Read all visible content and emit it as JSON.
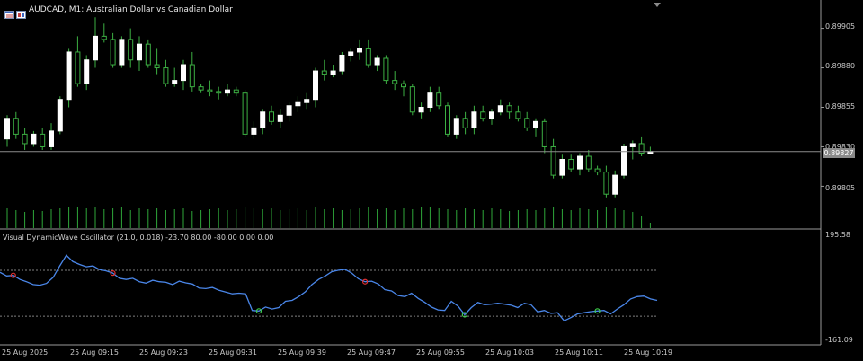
{
  "title": "AUDCAD, M1:  Australian Dollar vs Canadian Dollar",
  "indicator": "Visual DynamicWave Oscillator (21.0, 0.018) -23.70 80.00 -80.00 0.00 0.00",
  "price_axis": [
    "0.89905",
    "0.89880",
    "0.89855",
    "0.89830",
    "0.89805"
  ],
  "current_price": "0.89827",
  "osc_axis": [
    "195.58",
    "-161.09"
  ],
  "time_axis": [
    "25 Aug 2025",
    "25 Aug 09:15",
    "25 Aug 09:23",
    "25 Aug 09:31",
    "25 Aug 09:39",
    "25 Aug 09:47",
    "25 Aug 09:55",
    "25 Aug 10:03",
    "25 Aug 10:11",
    "25 Aug 10:19"
  ],
  "icons": [
    "chart-menu-icon",
    "one-click-trading-icon"
  ],
  "colors": {
    "background": "#000000",
    "bull_candle": "#ffffff",
    "wick": "#3cb043",
    "volume": "#2fa83a",
    "oscillator": "#4a86e8",
    "level_line": "#808080",
    "sell_signal": "#e03030",
    "buy_signal": "#3cd04a"
  },
  "chart_data": [
    {
      "type": "candlestick",
      "title": "AUDCAD, M1",
      "y_range": [
        0.89795,
        0.89915
      ],
      "candles": [
        [
          0.89835,
          0.8985,
          0.8983,
          0.89848
        ],
        [
          0.89848,
          0.89852,
          0.89835,
          0.89838
        ],
        [
          0.89838,
          0.89842,
          0.89828,
          0.89832
        ],
        [
          0.89832,
          0.8984,
          0.8983,
          0.89838
        ],
        [
          0.89838,
          0.89842,
          0.89828,
          0.8983
        ],
        [
          0.8983,
          0.89845,
          0.89828,
          0.8984
        ],
        [
          0.8984,
          0.89862,
          0.89838,
          0.8986
        ],
        [
          0.8986,
          0.89892,
          0.89855,
          0.8989
        ],
        [
          0.8989,
          0.899,
          0.89868,
          0.8987
        ],
        [
          0.8987,
          0.89888,
          0.89866,
          0.89885
        ],
        [
          0.89885,
          0.89912,
          0.8988,
          0.899
        ],
        [
          0.899,
          0.89908,
          0.89896,
          0.89898
        ],
        [
          0.89898,
          0.89902,
          0.8988,
          0.89882
        ],
        [
          0.89882,
          0.899,
          0.8988,
          0.89898
        ],
        [
          0.89898,
          0.89905,
          0.8988,
          0.89885
        ],
        [
          0.89885,
          0.899,
          0.89878,
          0.89895
        ],
        [
          0.89895,
          0.89898,
          0.8988,
          0.89882
        ],
        [
          0.89882,
          0.89892,
          0.89876,
          0.8988
        ],
        [
          0.8988,
          0.89885,
          0.89868,
          0.8987
        ],
        [
          0.8987,
          0.8988,
          0.89868,
          0.89872
        ],
        [
          0.89872,
          0.89885,
          0.89866,
          0.89882
        ],
        [
          0.89882,
          0.8989,
          0.89865,
          0.89868
        ],
        [
          0.89868,
          0.8987,
          0.89864,
          0.89866
        ],
        [
          0.89866,
          0.89872,
          0.89862,
          0.89865
        ],
        [
          0.89865,
          0.89868,
          0.8986,
          0.89864
        ],
        [
          0.89864,
          0.8987,
          0.89862,
          0.89866
        ],
        [
          0.89866,
          0.89868,
          0.89862,
          0.89864
        ],
        [
          0.89864,
          0.89866,
          0.89836,
          0.89838
        ],
        [
          0.89838,
          0.89846,
          0.89835,
          0.89842
        ],
        [
          0.89842,
          0.89854,
          0.89838,
          0.89852
        ],
        [
          0.89852,
          0.89856,
          0.89844,
          0.89846
        ],
        [
          0.89846,
          0.89854,
          0.89842,
          0.8985
        ],
        [
          0.8985,
          0.89858,
          0.89846,
          0.89856
        ],
        [
          0.89856,
          0.89862,
          0.89852,
          0.89858
        ],
        [
          0.89858,
          0.89864,
          0.89854,
          0.8986
        ],
        [
          0.8986,
          0.8988,
          0.89855,
          0.89878
        ],
        [
          0.89878,
          0.89885,
          0.89872,
          0.89876
        ],
        [
          0.89876,
          0.89882,
          0.89874,
          0.89878
        ],
        [
          0.89878,
          0.8989,
          0.89876,
          0.89888
        ],
        [
          0.89888,
          0.89892,
          0.89884,
          0.8989
        ],
        [
          0.8989,
          0.89898,
          0.89885,
          0.89892
        ],
        [
          0.89892,
          0.89898,
          0.8988,
          0.89882
        ],
        [
          0.89882,
          0.89888,
          0.89878,
          0.89886
        ],
        [
          0.89886,
          0.89888,
          0.8987,
          0.89872
        ],
        [
          0.89872,
          0.89878,
          0.89866,
          0.8987
        ],
        [
          0.8987,
          0.89872,
          0.89862,
          0.89868
        ],
        [
          0.89868,
          0.8987,
          0.8985,
          0.89852
        ],
        [
          0.89852,
          0.89858,
          0.89848,
          0.89855
        ],
        [
          0.89855,
          0.89868,
          0.89852,
          0.89864
        ],
        [
          0.89864,
          0.89868,
          0.89854,
          0.89856
        ],
        [
          0.89856,
          0.89858,
          0.89836,
          0.89838
        ],
        [
          0.89838,
          0.8985,
          0.89835,
          0.89848
        ],
        [
          0.89848,
          0.89852,
          0.89838,
          0.89842
        ],
        [
          0.89842,
          0.89856,
          0.89838,
          0.89852
        ],
        [
          0.89852,
          0.89856,
          0.89846,
          0.89848
        ],
        [
          0.89848,
          0.89854,
          0.89844,
          0.89852
        ],
        [
          0.89852,
          0.8986,
          0.8985,
          0.89856
        ],
        [
          0.89856,
          0.89858,
          0.89848,
          0.89852
        ],
        [
          0.89852,
          0.89856,
          0.89846,
          0.89848
        ],
        [
          0.89848,
          0.89852,
          0.8984,
          0.89842
        ],
        [
          0.89842,
          0.89848,
          0.89836,
          0.89846
        ],
        [
          0.89846,
          0.89848,
          0.89826,
          0.8983
        ],
        [
          0.8983,
          0.89835,
          0.8981,
          0.89812
        ],
        [
          0.89812,
          0.89825,
          0.8981,
          0.89822
        ],
        [
          0.89822,
          0.89825,
          0.89814,
          0.89816
        ],
        [
          0.89816,
          0.89826,
          0.89812,
          0.89824
        ],
        [
          0.89824,
          0.89828,
          0.89814,
          0.89816
        ],
        [
          0.89816,
          0.89818,
          0.89812,
          0.89814
        ],
        [
          0.89814,
          0.89818,
          0.89798,
          0.898
        ],
        [
          0.898,
          0.89815,
          0.89798,
          0.89812
        ],
        [
          0.89812,
          0.89832,
          0.8981,
          0.8983
        ],
        [
          0.8983,
          0.89834,
          0.89822,
          0.89832
        ],
        [
          0.89832,
          0.89836,
          0.89824,
          0.89826
        ],
        [
          0.89826,
          0.8983,
          0.89826,
          0.89827
        ]
      ],
      "volume": [
        22,
        20,
        18,
        20,
        19,
        21,
        22,
        24,
        23,
        22,
        24,
        21,
        22,
        23,
        20,
        22,
        21,
        22,
        20,
        21,
        22,
        19,
        20,
        21,
        22,
        20,
        21,
        23,
        22,
        21,
        22,
        20,
        21,
        22,
        20,
        23,
        21,
        22,
        20,
        21,
        22,
        23,
        21,
        22,
        20,
        22,
        21,
        23,
        24,
        22,
        21,
        20,
        22,
        21,
        20,
        22,
        21,
        19,
        20,
        21,
        20,
        22,
        24,
        21,
        20,
        22,
        21,
        20,
        24,
        22,
        20,
        18,
        14,
        6
      ],
      "current": 0.89827
    },
    {
      "type": "line",
      "title": "Visual DynamicWave Oscillator",
      "y_range": [
        -161.09,
        195.58
      ],
      "levels": [
        80,
        -80
      ],
      "values": [
        73,
        60,
        62,
        48,
        40,
        30,
        28,
        34,
        55,
        95,
        132,
        110,
        100,
        92,
        95,
        82,
        78,
        70,
        52,
        48,
        52,
        40,
        35,
        45,
        40,
        38,
        30,
        42,
        36,
        32,
        18,
        16,
        20,
        10,
        4,
        -2,
        0,
        -2,
        -60,
        -62,
        -48,
        -55,
        -50,
        -28,
        -25,
        -12,
        5,
        30,
        48,
        60,
        75,
        80,
        83,
        70,
        50,
        40,
        42,
        32,
        12,
        8,
        -8,
        -12,
        0,
        -18,
        -32,
        -48,
        -58,
        -60,
        -28,
        -45,
        -75,
        -50,
        -32,
        -40,
        -38,
        -35,
        -38,
        -42,
        -50,
        -35,
        -40,
        -65,
        -60,
        -70,
        -68,
        -96,
        -85,
        -72,
        -68,
        -64,
        -62,
        -60,
        -72,
        -55,
        -40,
        -20,
        -12,
        -10,
        -20,
        -25
      ],
      "sell_signal_indices": [
        2,
        17,
        55
      ],
      "buy_signal_indices": [
        39,
        70,
        90
      ]
    }
  ]
}
